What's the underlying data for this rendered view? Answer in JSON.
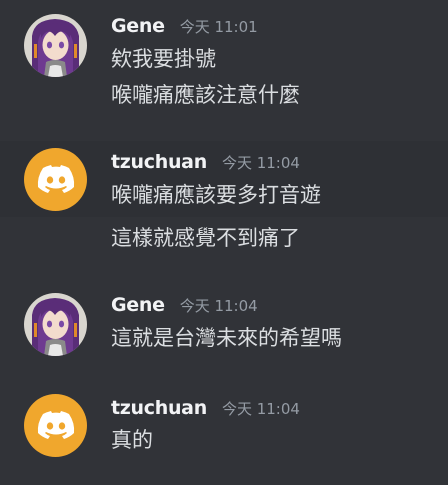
{
  "messages": [
    {
      "user": "Gene",
      "time": "今天 11:01",
      "avatar": "gene-avatar",
      "lines": [
        "欸我要掛號",
        "喉嚨痛應該注意什麼"
      ]
    },
    {
      "user": "tzuchuan",
      "time": "今天 11:04",
      "avatar": "discord-avatar",
      "lines": [
        "喉嚨痛應該要多打音遊",
        "這樣就感覺不到痛了"
      ]
    },
    {
      "user": "Gene",
      "time": "今天 11:04",
      "avatar": "gene-avatar",
      "lines": [
        "這就是台灣未來的希望嗎"
      ]
    },
    {
      "user": "tzuchuan",
      "time": "今天 11:04",
      "avatar": "discord-avatar",
      "lines": [
        "真的"
      ]
    }
  ],
  "colors": {
    "background": "#313338",
    "hover_background": "#2e3035",
    "username": "#f2f3f5",
    "timestamp": "#949ba4",
    "text": "#dbdee1",
    "discord_avatar": "#f0a72d"
  }
}
